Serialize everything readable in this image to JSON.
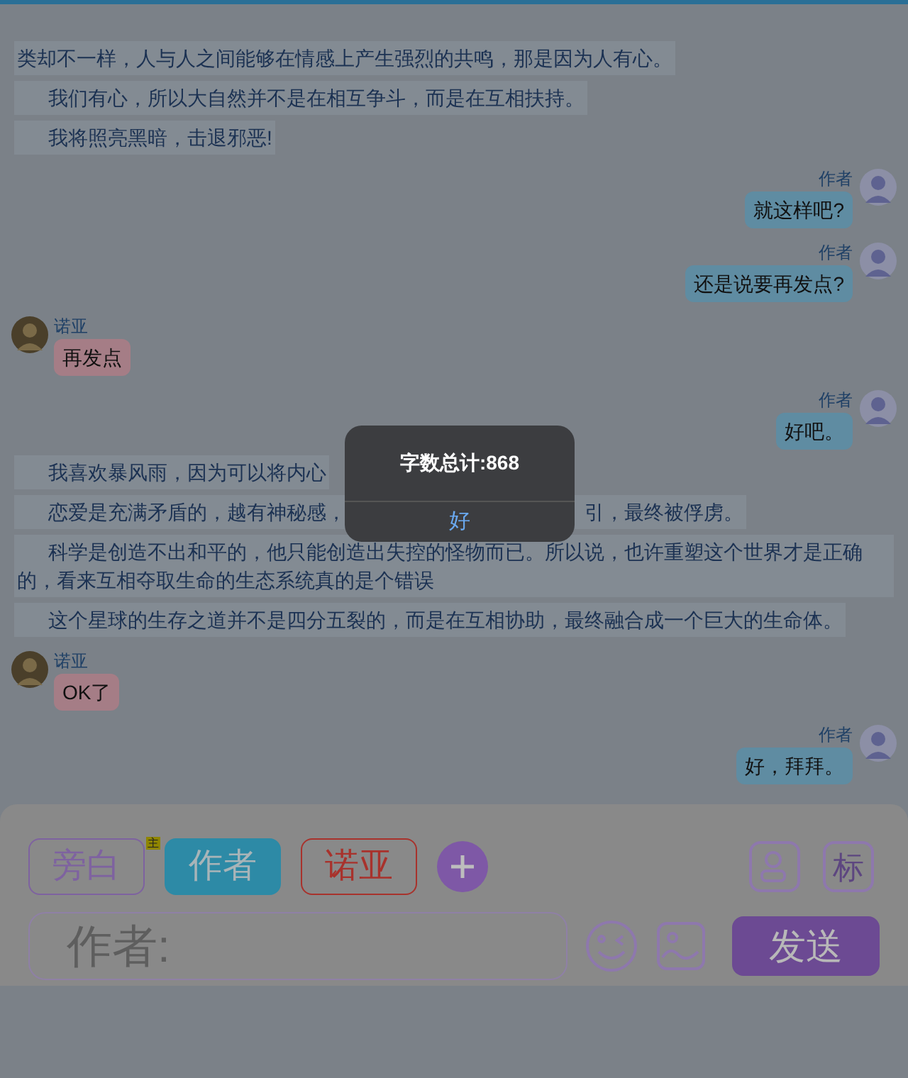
{
  "messages": [
    {
      "kind": "narration_tail",
      "segments": [
        "类却不一样，人与人之间能够在情感上产生强烈的共鸣，那是因为人有心。"
      ]
    },
    {
      "kind": "narration",
      "segments": [
        "我们有心，所以大自然并不是在相互争斗，而是在互相扶持。"
      ]
    },
    {
      "kind": "narration",
      "segments": [
        "我将照亮黑暗，击退邪恶!"
      ]
    },
    {
      "kind": "right",
      "name": "作者",
      "text": "就这样吧?"
    },
    {
      "kind": "right",
      "name": "作者",
      "text": "还是说要再发点?"
    },
    {
      "kind": "left",
      "name": "诺亚",
      "text": "再发点"
    },
    {
      "kind": "right",
      "name": "作者",
      "text": "好吧。"
    },
    {
      "kind": "narration",
      "segments": [
        "我喜欢暴风雨，因为可以将内心"
      ]
    },
    {
      "kind": "narration",
      "segments": [
        "恋爱是充满矛盾的，越有神秘感，",
        "引，最终被俘虏。"
      ]
    },
    {
      "kind": "narration",
      "segments": [
        "科学是创造不出和平的，他只能创造出失控的怪物而已。所以说，也许重塑这个世界才是正确的，看来互相夺取生命的生态系统真的是个错误"
      ]
    },
    {
      "kind": "narration",
      "segments": [
        "这个星球的生存之道并不是四分五裂的，而是在互相协助，最终融合成一个巨大的生命体。"
      ]
    },
    {
      "kind": "left",
      "name": "诺亚",
      "text": "OK了"
    },
    {
      "kind": "right",
      "name": "作者",
      "text": "好，拜拜。"
    }
  ],
  "roles": [
    {
      "label": "旁白",
      "selected": false,
      "color": "#7e62a0",
      "badge": "主"
    },
    {
      "label": "作者",
      "selected": true,
      "color": "#2d8aa6"
    },
    {
      "label": "诺亚",
      "selected": false,
      "color": "#a8322c"
    }
  ],
  "mark_button": "标",
  "input": {
    "placeholder": "作者:"
  },
  "send_button": "发送",
  "dialog": {
    "message": "字数总计:868",
    "button": "好"
  }
}
